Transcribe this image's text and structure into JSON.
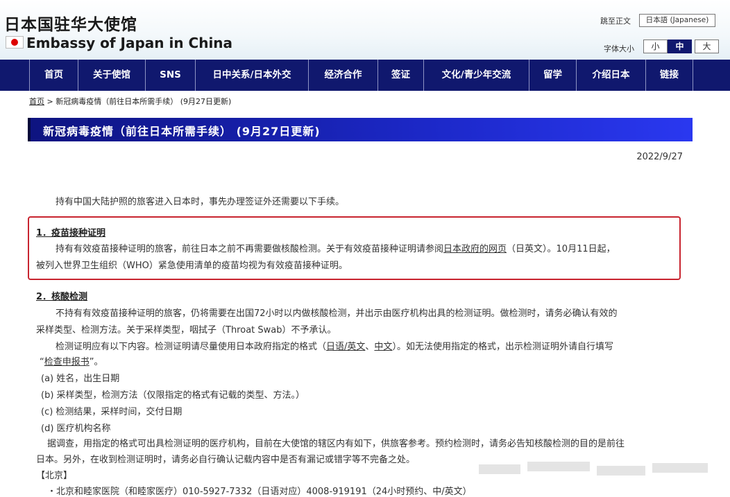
{
  "header": {
    "title_jp": "日本国驻华大使馆",
    "title_en": "Embassy of Japan in China",
    "skip_link": "跳至正文",
    "lang_button": "日本語 (Japanese)",
    "fontsize_label": "字体大小",
    "fontsize_small": "小",
    "fontsize_mid": "中",
    "fontsize_large": "大",
    "flag_icon": "japan-flag-icon"
  },
  "nav": {
    "items": [
      {
        "label": "首页"
      },
      {
        "label": "关于使馆"
      },
      {
        "label": "SNS"
      },
      {
        "label": "日中关系/日本外交"
      },
      {
        "label": "经济合作"
      },
      {
        "label": "签证"
      },
      {
        "label": "文化/青少年交流"
      },
      {
        "label": "留学"
      },
      {
        "label": "介绍日本"
      },
      {
        "label": "链接"
      }
    ]
  },
  "breadcrumb": {
    "home": "首页",
    "sep": ">",
    "current": "新冠病毒疫情（前往日本所需手续） (9月27日更新)"
  },
  "page": {
    "title": "新冠病毒疫情（前往日本所需手续） (9月27日更新)",
    "date": "2022/9/27",
    "intro": "持有中国大陆护照的旅客进入日本时，事先办理签证外还需要以下手续。"
  },
  "section1": {
    "title": "1．疫苗接种证明",
    "text_a": "持有有效疫苗接种证明的旅客，前往日本之前不再需要做核酸检测。关于有效疫苗接种证明请参阅",
    "link": "日本政府的网页",
    "text_b": "（日英文）。10月11日起，",
    "text_c": "被列入世界卫生组织（WHO）紧急使用清单的疫苗均视为有效疫苗接种证明。"
  },
  "section2": {
    "title": "2．核酸检测",
    "p1_line1": "不持有有效疫苗接种证明的旅客，仍将需要在出国72小时以内做核酸检测，并出示由医疗机构出具的检测证明。做检测时，请务必确认有效的",
    "p1_line2": "采样类型、检测方法。关于采样类型，咽拭子（Throat Swab）不予承认。",
    "p2_a": "检测证明应有以下内容。检测证明请尽量使用日本政府指定的格式（",
    "p2_link1": "日语/英文",
    "p2_sep": "、",
    "p2_link2": "中文",
    "p2_b": "）。如无法使用指定的格式，出示检测证明外请自行填写",
    "p2_quote_open": "“",
    "p2_link3": "检查申报书",
    "p2_quote_close": "”。",
    "items": [
      "(a) 姓名，出生日期",
      "(b) 采样类型，检测方法（仅限指定的格式有记载的类型、方法。）",
      "(c) 检测结果，采样时间，交付日期",
      "(d) 医疗机构名称"
    ],
    "p3_line1": "据调查，用指定的格式可出具检测证明的医疗机构，目前在大使馆的辖区内有如下，供旅客参考。预约检测时，请务必告知核酸检测的目的是前往",
    "p3_line2": "日本。另外，在收到检测证明时，请务必自行确认记载内容中是否有漏记或错字等不完备之处。",
    "city": "【北京】",
    "hospital": "・北京和睦家医院（和睦家医疗）010-5927-7332（日语对应）4008-919191（24小时预约、中/英文）"
  }
}
